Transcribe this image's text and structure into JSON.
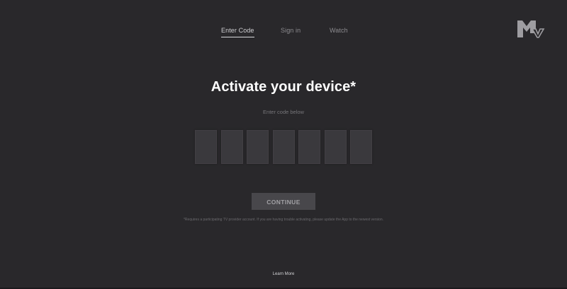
{
  "nav": {
    "steps": [
      {
        "label": "Enter Code",
        "active": true
      },
      {
        "label": "Sign in",
        "active": false
      },
      {
        "label": "Watch",
        "active": false
      }
    ]
  },
  "logo": {
    "icon": "mtv-logo-icon",
    "text": "MTV",
    "color": "#9e9da1"
  },
  "main": {
    "title": "Activate your device*",
    "subtitle": "Enter code below",
    "code_values": [
      "",
      "",
      "",
      "",
      "",
      "",
      ""
    ],
    "continue_label": "CONTINUE",
    "disclaimer": "*Requires a participating TV provider account. If you are having trouble activating, please update the App to the newest version."
  },
  "footer": {
    "learn_more": "Learn More"
  },
  "colors": {
    "background": "#29282b",
    "code_box": "#3a393d",
    "button": "#48474b"
  }
}
